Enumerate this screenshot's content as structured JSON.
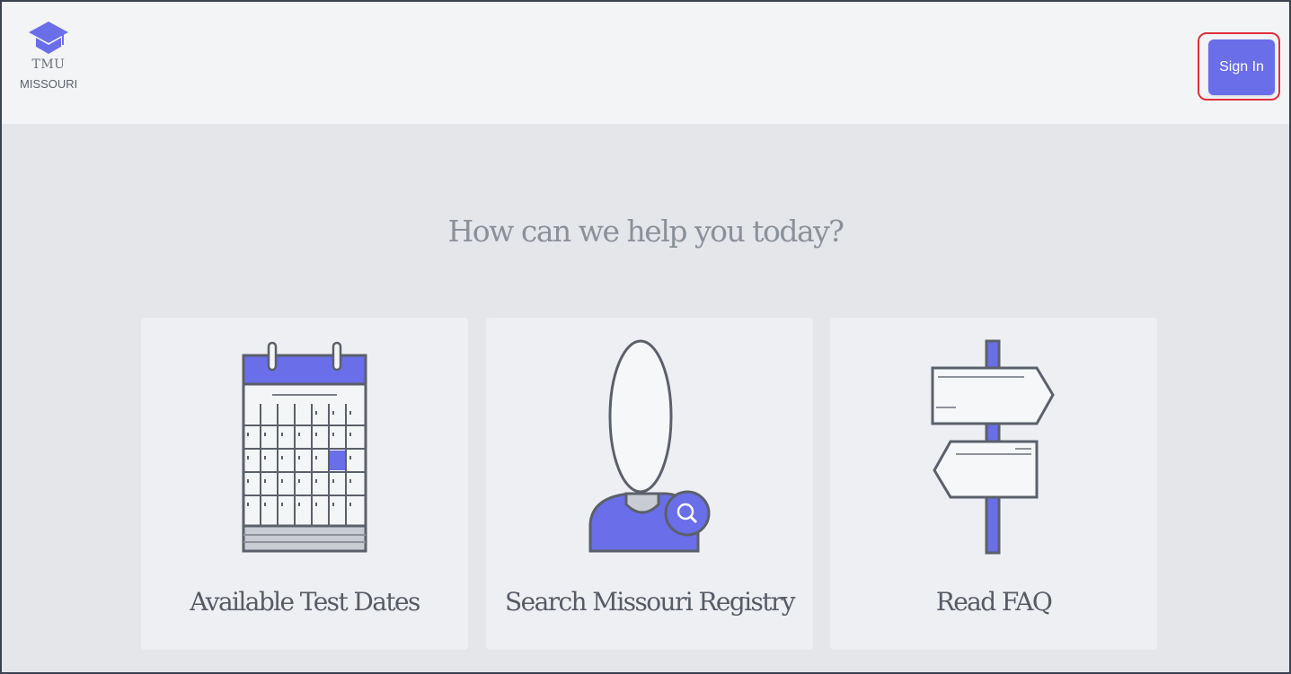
{
  "brand": {
    "line1": "TMU",
    "line2": "MISSOURI",
    "icon": "graduation-cap-icon"
  },
  "header": {
    "signin_label": "Sign In"
  },
  "main": {
    "heading": "How can we help you today?",
    "cards": [
      {
        "label": "Available Test Dates",
        "icon": "calendar-icon"
      },
      {
        "label": "Search Missouri Registry",
        "icon": "person-search-icon"
      },
      {
        "label": "Read FAQ",
        "icon": "signpost-icon"
      }
    ]
  },
  "colors": {
    "accent": "#6a6ee8",
    "highlight_border": "#e0303a",
    "background": "#e4e6ea",
    "card": "#eeeff2",
    "outline": "#5b606a"
  }
}
